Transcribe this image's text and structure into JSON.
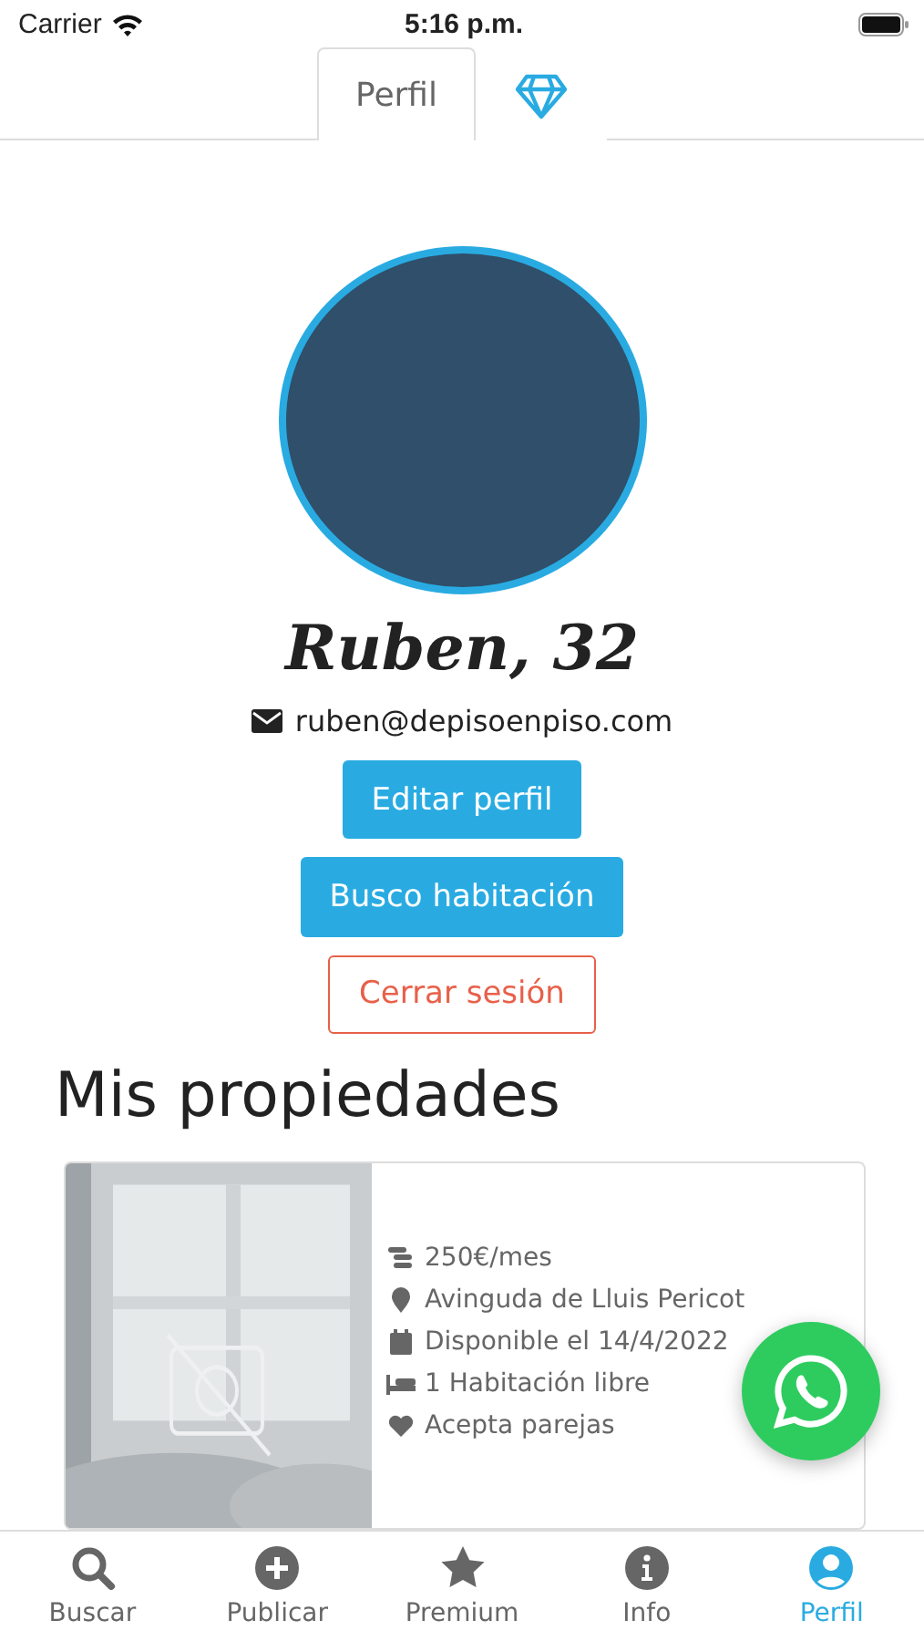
{
  "status_bar": {
    "carrier": "Carrier",
    "time": "5:16 p.m."
  },
  "tabs": [
    {
      "label": "Perfil",
      "selected": true
    },
    {
      "selected": false
    }
  ],
  "profile": {
    "name": "Ruben, 32",
    "email": "ruben@depisoenpiso.com"
  },
  "buttons": [
    {
      "label": "Editar perfil",
      "kind": "primary"
    },
    {
      "label": "Busco habitación",
      "kind": "primary"
    },
    {
      "label": "Cerrar sesión",
      "kind": "outline"
    }
  ],
  "section_title": "Mis propiedades",
  "property": {
    "details": [
      "250€/mes",
      "Avinguda de Lluis Pericot",
      "Disponible el 14/4/2022",
      "1 Habitación libre",
      "Acepta parejas"
    ]
  },
  "nav": [
    {
      "label": "Buscar",
      "selected": false
    },
    {
      "label": "Publicar",
      "selected": false
    },
    {
      "label": "Premium",
      "selected": false
    },
    {
      "label": "Info",
      "selected": false
    },
    {
      "label": "Perfil",
      "selected": true
    }
  ]
}
